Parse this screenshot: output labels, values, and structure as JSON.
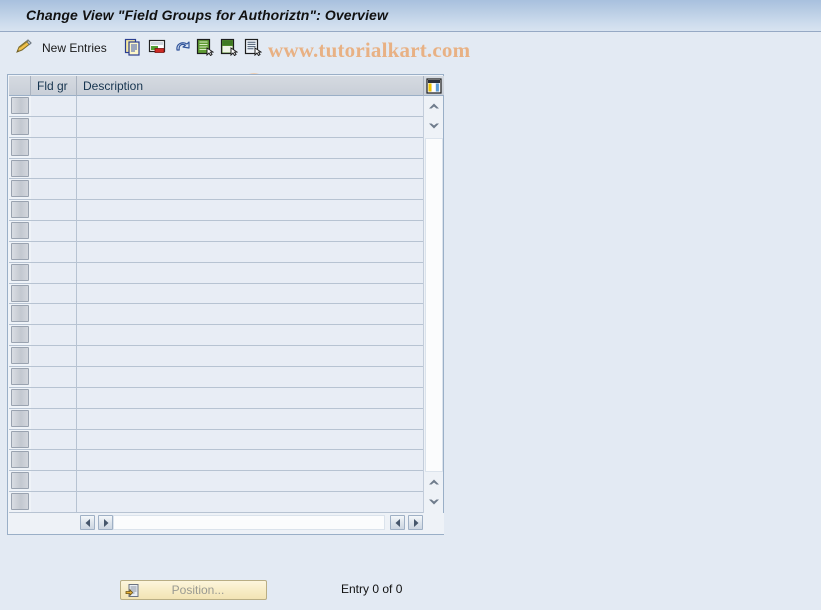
{
  "window": {
    "title": "Change View \"Field Groups for Authoriztn\": Overview"
  },
  "toolbar": {
    "display_change_icon": "pencil-icon",
    "new_entries_label": "New Entries",
    "buttons": [
      {
        "name": "copy-as-button",
        "icon": "copy-documents-icon"
      },
      {
        "name": "delete-button",
        "icon": "cut-delete-icon"
      },
      {
        "name": "undo-button",
        "icon": "undo-arrow-icon"
      },
      {
        "name": "select-all-button",
        "icon": "select-all-icon"
      },
      {
        "name": "deselect-all-button",
        "icon": "deselect-all-icon"
      },
      {
        "name": "details-button",
        "icon": "details-document-icon"
      }
    ]
  },
  "watermark": {
    "text": "www.tutorialkart.com"
  },
  "table": {
    "columns": [
      {
        "key": "select",
        "label": ""
      },
      {
        "key": "fld_gr",
        "label": "Fld gr"
      },
      {
        "key": "description",
        "label": "Description"
      }
    ],
    "config_icon": "table-settings-icon",
    "rows": [],
    "empty_row_count": 20,
    "vertical_scroll": {
      "up_icon": "scroll-up-icon",
      "down_icon": "scroll-down-icon"
    },
    "horizontal_scroll": {
      "left_icon": "scroll-left-icon",
      "right_icon": "scroll-right-icon"
    }
  },
  "footer": {
    "position_button_label": "Position...",
    "position_button_icon": "position-icon",
    "position_button_enabled": false,
    "entry_status": "Entry 0 of 0"
  },
  "colors": {
    "page_background": "#e3eaf3",
    "titlebar_gradient_top": "#a8c0de",
    "titlebar_gradient_bottom": "#d8e3f0",
    "table_header": "#ccd1d9",
    "cell_background": "#e8edf5",
    "panel_border": "#9aafc7",
    "watermark": "#e8b184",
    "position_button": "#f5e9bd"
  }
}
